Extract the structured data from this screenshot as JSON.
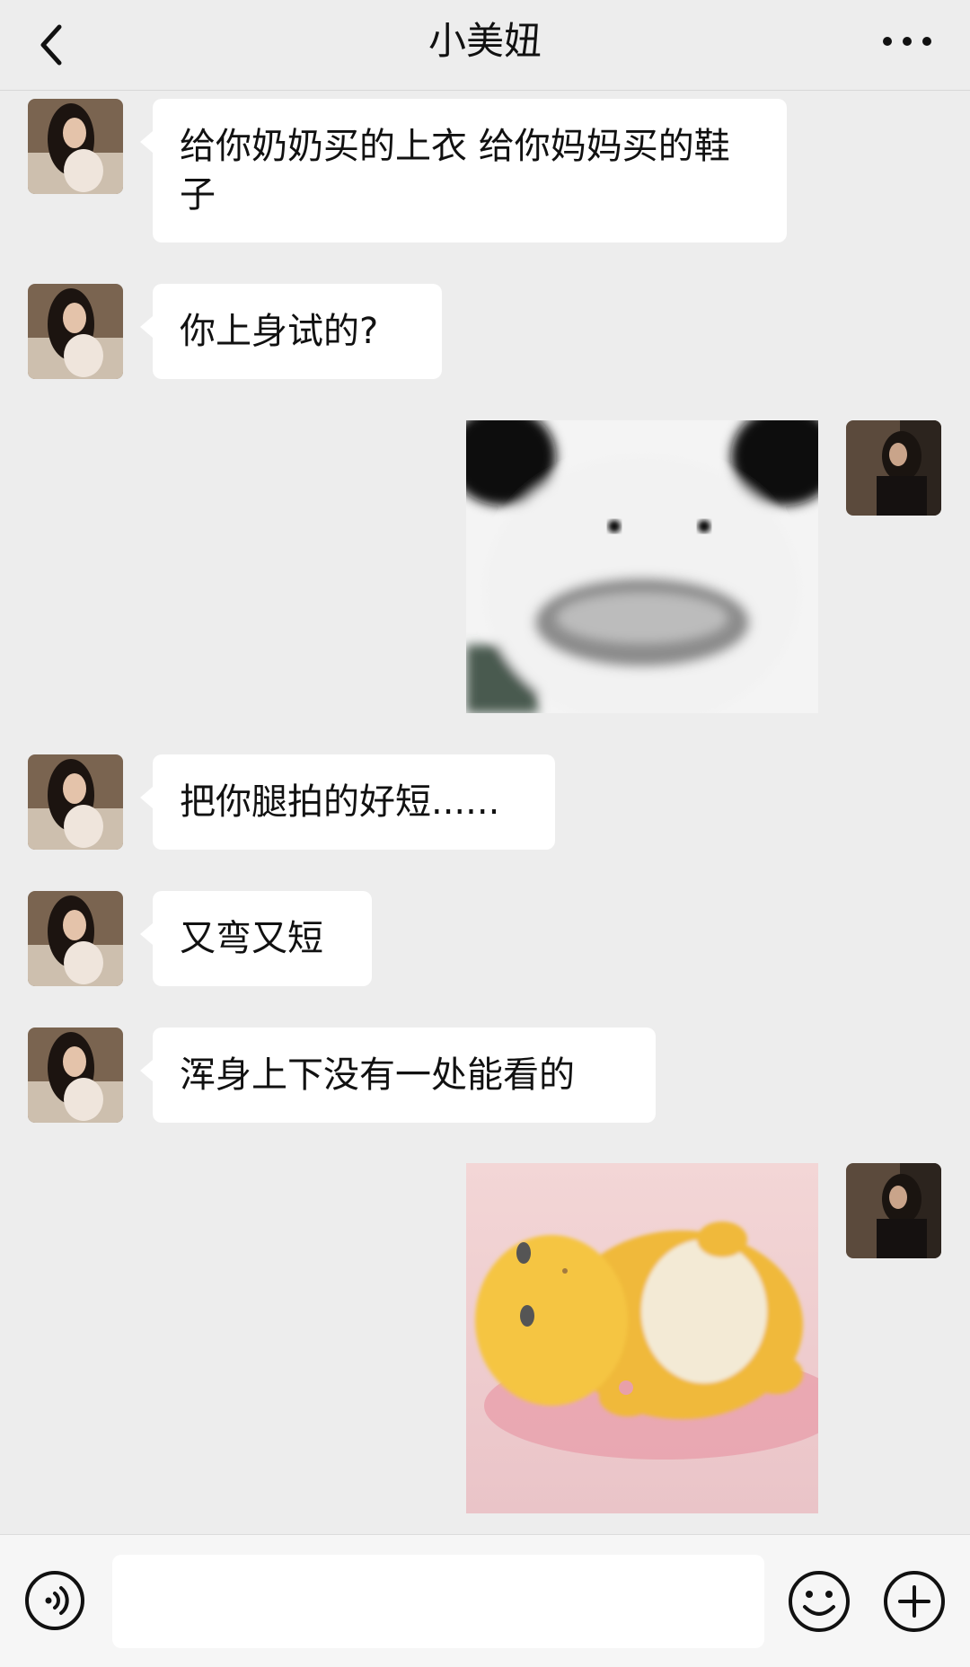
{
  "header": {
    "title": "小美妞",
    "back_icon": "chevron-left-icon",
    "more_icon": "more-dots-icon"
  },
  "messages": [
    {
      "side": "left",
      "type": "text",
      "text": "给你奶奶买的上衣 给你妈妈买的鞋子"
    },
    {
      "side": "left",
      "type": "text",
      "text": "你上身试的?"
    },
    {
      "side": "right",
      "type": "sticker",
      "sticker": "panda-face-sticker"
    },
    {
      "side": "left",
      "type": "text",
      "text": "把你腿拍的好短......"
    },
    {
      "side": "left",
      "type": "text",
      "text": "又弯又短"
    },
    {
      "side": "left",
      "type": "text",
      "text": "浑身上下没有一处能看的"
    },
    {
      "side": "right",
      "type": "sticker",
      "sticker": "yellow-dinosaur-sticker"
    }
  ],
  "input_bar": {
    "voice_icon": "voice-icon",
    "text_value": "",
    "emoji_icon": "emoji-icon",
    "plus_icon": "plus-icon"
  },
  "colors": {
    "background": "#ededed",
    "bubble_incoming": "#ffffff"
  }
}
